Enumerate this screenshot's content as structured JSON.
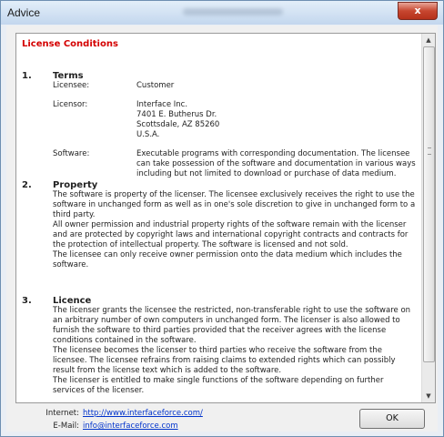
{
  "window": {
    "title": "Advice",
    "close_symbol": "x"
  },
  "doc": {
    "heading": "License Conditions",
    "terms": {
      "num": "1.",
      "title": "Terms",
      "licensee_label": "Licensee:",
      "licensee_value": "Customer",
      "licensor_label": "Licensor:",
      "licensor_lines": [
        "Interface Inc.",
        "7401 E. Butherus Dr.",
        "Scottsdale, AZ 85260",
        "U.S.A."
      ],
      "software_label": "Software:",
      "software_value": "Executable programs with corresponding documentation. The licensee can take possession of the software and documentation in various ways including but not limited to download or purchase of data medium."
    },
    "property": {
      "num": "2.",
      "title": "Property",
      "paragraphs": [
        "The software is property of the licenser. The licensee exclusively receives the right to use the software in unchanged form as well as in one's sole discretion to give in unchanged form to a third party.",
        "All owner permission and industrial property rights of the software remain with the licenser and are protected by copyright laws and international copyright contracts and contracts for the protection of intellectual property. The software is licensed and not sold.",
        "The licensee can only receive owner permission onto the data medium which includes the software."
      ]
    },
    "licence": {
      "num": "3.",
      "title": "Licence",
      "paragraphs": [
        "The licenser grants the licensee the restricted, non-transferable right to use the software on an arbitrary number of own computers in unchanged form. The licenser is also allowed to furnish the software to third parties provided that the receiver agrees with the license conditions contained in the software.",
        "The licensee becomes the licenser to third parties who receive the software from the licensee. The licensee refrains from raising claims to extended rights which can possibly result from the license text which is added to the software.",
        "The licenser is entitled to make single functions of the software depending on further services of the licenser."
      ]
    }
  },
  "footer": {
    "internet_label": "Internet:",
    "internet_link": "http://www.interfaceforce.com/",
    "email_label": "E-Mail:",
    "email_link": "info@interfaceforce.com",
    "ok_label": "OK"
  },
  "icons": {
    "scroll_up": "triangle-up",
    "scroll_down": "triangle-down"
  }
}
